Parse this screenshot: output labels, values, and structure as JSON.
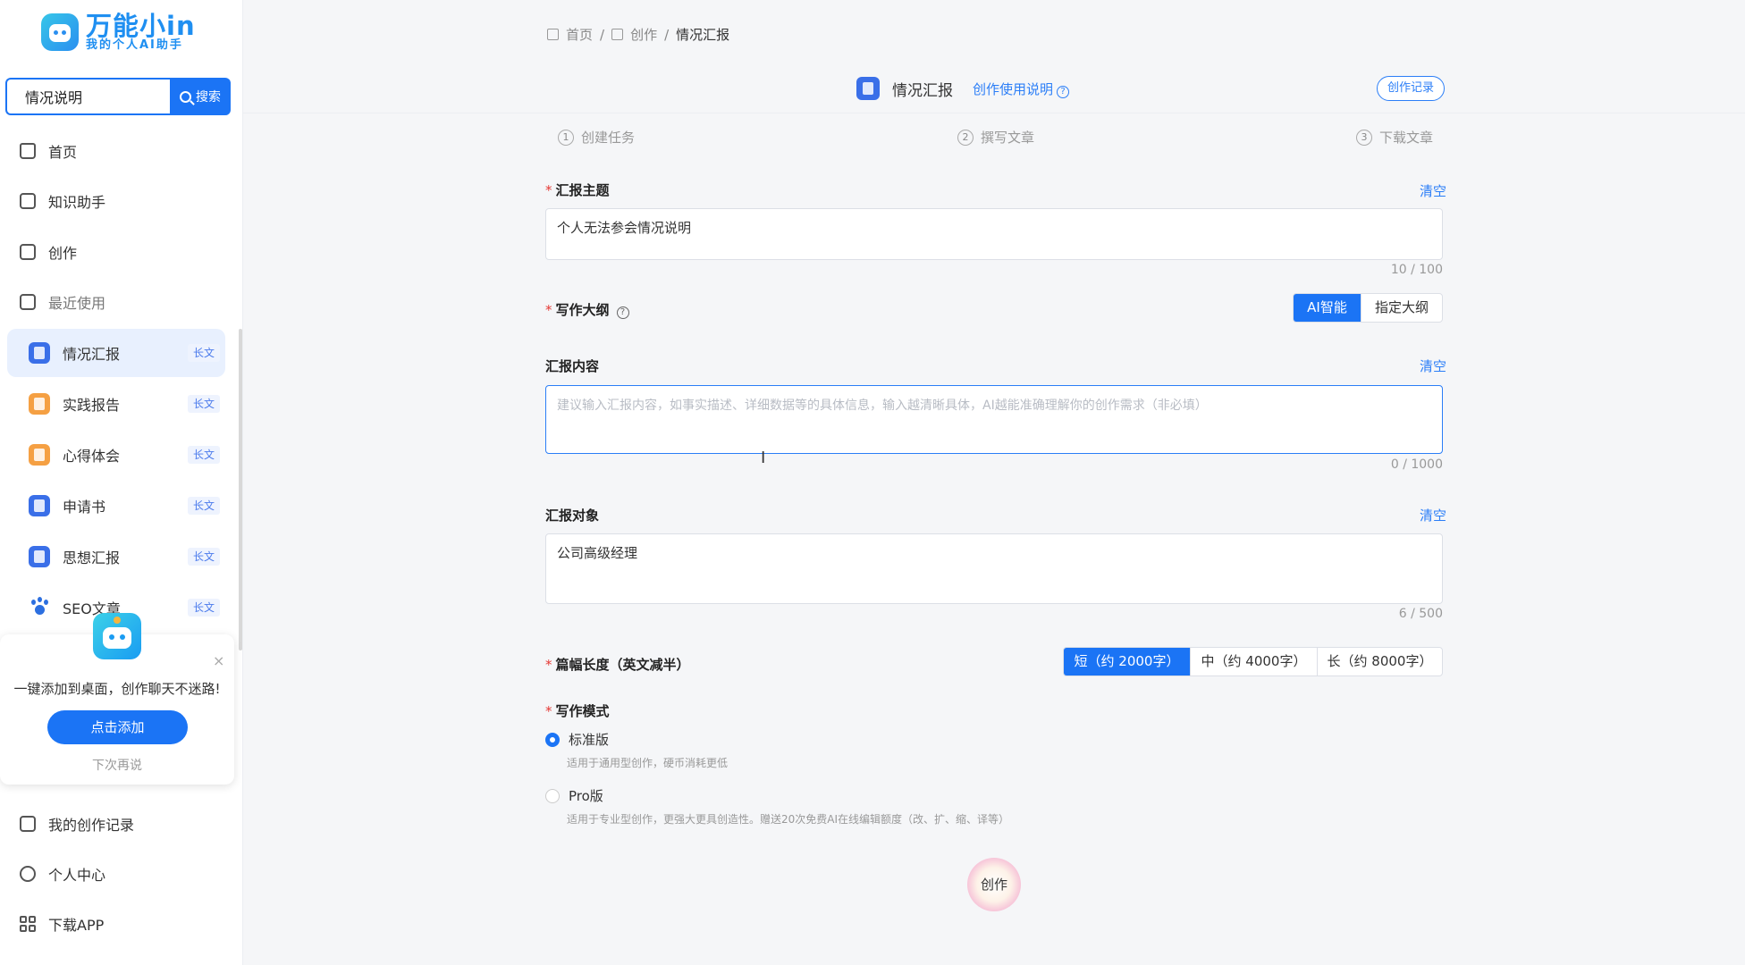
{
  "logo": {
    "title": "万能小in",
    "subtitle": "我的个人AI助手"
  },
  "search": {
    "value": "情况说明",
    "button": "搜索"
  },
  "nav": {
    "home": "首页",
    "knowledge": "知识助手",
    "create": "创作",
    "recent": "最近使用"
  },
  "recent_items": [
    {
      "label": "情况汇报",
      "tag": "长文"
    },
    {
      "label": "实践报告",
      "tag": "长文"
    },
    {
      "label": "心得体会",
      "tag": "长文"
    },
    {
      "label": "申请书",
      "tag": "长文"
    },
    {
      "label": "思想汇报",
      "tag": "长文"
    },
    {
      "label": "SEO文章",
      "tag": "长文"
    }
  ],
  "promo": {
    "text": "一键添加到桌面，创作聊天不迷路!",
    "button": "点击添加",
    "later": "下次再说",
    "close": "×"
  },
  "bottom_nav": {
    "records": "我的创作记录",
    "profile": "个人中心",
    "download": "下载APP"
  },
  "breadcrumb": [
    "首页",
    "创作",
    "情况汇报"
  ],
  "header": {
    "title": "情况汇报",
    "help_link": "创作使用说明",
    "help_icon": "?",
    "history_button": "创作记录"
  },
  "steps": [
    {
      "num": "1",
      "label": "创建任务"
    },
    {
      "num": "2",
      "label": "撰写文章"
    },
    {
      "num": "3",
      "label": "下载文章"
    }
  ],
  "form": {
    "topic": {
      "label": "汇报主题",
      "value": "个人无法参会情况说明",
      "count": "10 / 100",
      "clear": "清空"
    },
    "outline": {
      "label": "写作大纲",
      "help": "?",
      "options": [
        "AI智能",
        "指定大纲"
      ],
      "selected": "AI智能"
    },
    "content": {
      "label": "汇报内容",
      "placeholder": "建议输入汇报内容，如事实描述、详细数据等的具体信息，输入越清晰具体，AI越能准确理解你的创作需求（非必填）",
      "count": "0 / 1000",
      "clear": "清空"
    },
    "audience": {
      "label": "汇报对象",
      "value": "公司高级经理",
      "count": "6 / 500",
      "clear": "清空"
    },
    "length": {
      "label": "篇幅长度（英文减半）",
      "options": [
        "短（约 2000字）",
        "中（约 4000字）",
        "长（约 8000字）"
      ],
      "selected": "短（约 2000字）"
    },
    "mode": {
      "label": "写作模式",
      "options": [
        {
          "label": "标准版",
          "desc": "适用于通用型创作，硬币消耗更低",
          "selected": true
        },
        {
          "label": "Pro版",
          "desc": "适用于专业型创作，更强大更具创造性。赠送20次免费AI在线编辑额度（改、扩、缩、译等）",
          "selected": false
        }
      ]
    },
    "submit": "创作"
  },
  "colors": {
    "primary": "#1b74f5",
    "link": "#2b7ef7",
    "required": "#e53935",
    "active_bg": "#e8f0fe"
  }
}
